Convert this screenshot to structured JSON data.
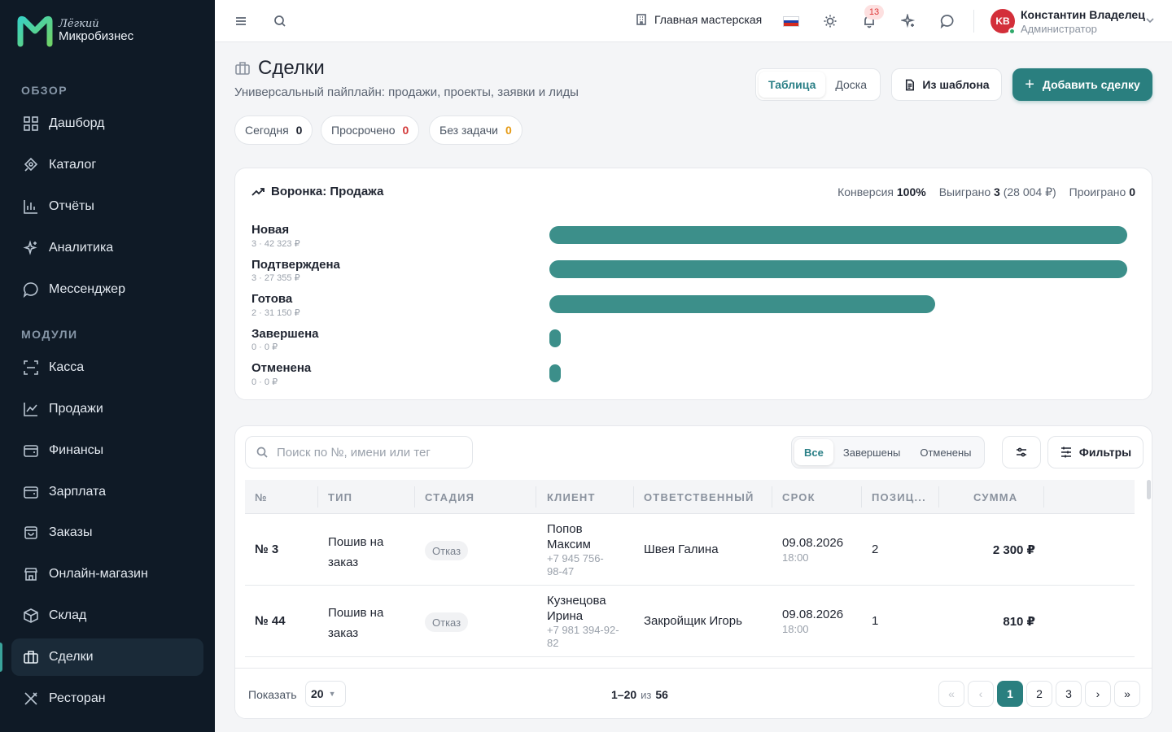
{
  "brand": {
    "top": "Лёгкий",
    "bottom": "Микробизнес"
  },
  "sidebar": {
    "sections": [
      {
        "title": "ОБЗОР"
      },
      {
        "title": "МОДУЛИ"
      }
    ],
    "items": [
      {
        "label": "Дашборд",
        "icon": "dashboard-icon"
      },
      {
        "label": "Каталог",
        "icon": "catalog-icon"
      },
      {
        "label": "Отчёты",
        "icon": "reports-icon"
      },
      {
        "label": "Аналитика",
        "icon": "sparkles-icon"
      },
      {
        "label": "Мессенджер",
        "icon": "chat-icon"
      },
      {
        "label": "Касса",
        "icon": "scan-icon"
      },
      {
        "label": "Продажи",
        "icon": "line-chart-icon"
      },
      {
        "label": "Финансы",
        "icon": "wallet-icon"
      },
      {
        "label": "Зарплата",
        "icon": "wallet-icon"
      },
      {
        "label": "Заказы",
        "icon": "bag-icon"
      },
      {
        "label": "Онлайн-магазин",
        "icon": "store-icon"
      },
      {
        "label": "Склад",
        "icon": "box-icon"
      },
      {
        "label": "Сделки",
        "icon": "briefcase-icon",
        "active": true
      },
      {
        "label": "Ресторан",
        "icon": "utensils-icon"
      }
    ]
  },
  "topbar": {
    "workshop": "Главная мастерская",
    "notifications_count": "13",
    "user": {
      "initials": "KB",
      "name": "Константин Владелец",
      "role": "Администратор"
    }
  },
  "page": {
    "title": "Сделки",
    "subtitle": "Универсальный пайплайн: продажи, проекты, заявки и лиды",
    "view_tabs": [
      "Таблица",
      "Доска"
    ],
    "active_view": "Таблица",
    "template_button": "Из шаблона",
    "add_button": "Добавить сделку",
    "chips": [
      {
        "label": "Сегодня",
        "count": "0",
        "color": "#1f2430"
      },
      {
        "label": "Просрочено",
        "count": "0",
        "color": "#d33a3a"
      },
      {
        "label": "Без задачи",
        "count": "0",
        "color": "#e59a14"
      }
    ]
  },
  "funnel": {
    "title": "Воронка: Продажа",
    "conversion_label": "Конверсия",
    "conversion_value": "100%",
    "won_label": "Выиграно",
    "won_count": "3",
    "won_sum": "(28 004 ₽)",
    "lost_label": "Проиграно",
    "lost_count": "0",
    "bar_color": "#3c8f8a",
    "stages": [
      {
        "name": "Новая",
        "meta": "3 · 42 323 ₽",
        "share": 1.0
      },
      {
        "name": "Подтверждена",
        "meta": "3 · 27 355 ₽",
        "share": 1.0
      },
      {
        "name": "Готова",
        "meta": "2 · 31 150 ₽",
        "share": 0.667
      },
      {
        "name": "Завершена",
        "meta": "0 · 0 ₽",
        "share": 0
      },
      {
        "name": "Отменена",
        "meta": "0 · 0 ₽",
        "share": 0
      }
    ]
  },
  "table": {
    "search_placeholder": "Поиск по №, имени или тег",
    "status_filters": [
      "Все",
      "Завершены",
      "Отменены"
    ],
    "active_status": "Все",
    "filters_button": "Фильтры",
    "columns": [
      "№",
      "ТИП",
      "СТАДИЯ",
      "КЛИЕНТ",
      "ОТВЕТСТВЕННЫЙ",
      "СРОК",
      "ПОЗИЦ...",
      "СУММА"
    ],
    "rows": [
      {
        "num": "№ 3",
        "type": [
          "Пошив на",
          "заказ"
        ],
        "stage": "Отказ",
        "client_name": [
          "Попов",
          "Максим"
        ],
        "client_phone": [
          "+7 945 756-",
          "98-47"
        ],
        "responsible": "Швея Галина",
        "date": "09.08.2026",
        "time": "18:00",
        "positions": "2",
        "sum": "2 300 ₽"
      },
      {
        "num": "№ 44",
        "type": [
          "Пошив на",
          "заказ"
        ],
        "stage": "Отказ",
        "client_name": [
          "Кузнецова",
          "Ирина"
        ],
        "client_phone": [
          "+7 981 394-92-",
          "82"
        ],
        "responsible": "Закройщик Игорь",
        "date": "09.08.2026",
        "time": "18:00",
        "positions": "1",
        "sum": "810 ₽"
      }
    ],
    "footer": {
      "show_label": "Показать",
      "page_size": "20",
      "range": "1–20",
      "of_label": "из",
      "total": "56",
      "pages": [
        "1",
        "2",
        "3"
      ],
      "current_page": "1",
      "first": "«",
      "prev": "‹",
      "next": "›",
      "last": "»"
    }
  }
}
